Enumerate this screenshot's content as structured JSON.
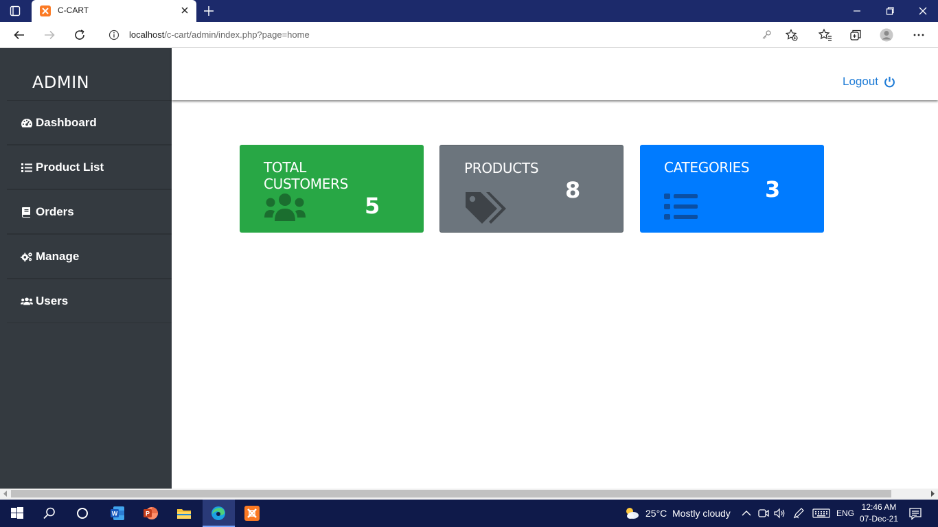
{
  "browser": {
    "tab_title": "C-CART",
    "url_host": "localhost",
    "url_path": "/c-cart/admin/index.php?page=home"
  },
  "sidebar": {
    "brand": "ADMIN",
    "items": [
      {
        "label": "Dashboard",
        "icon": "tachometer-icon"
      },
      {
        "label": "Product List",
        "icon": "list-icon"
      },
      {
        "label": "Orders",
        "icon": "book-icon"
      },
      {
        "label": "Manage",
        "icon": "cogs-icon"
      },
      {
        "label": "Users",
        "icon": "users-icon"
      }
    ]
  },
  "header": {
    "logout_label": "Logout"
  },
  "cards": [
    {
      "title": "TOTAL CUSTOMERS",
      "count": "5",
      "color": "#28a745",
      "icon": "users-icon"
    },
    {
      "title": "PRODUCTS",
      "count": "8",
      "color": "#6c757d",
      "icon": "tags-icon"
    },
    {
      "title": "CATEGORIES",
      "count": "3",
      "color": "#007bff",
      "icon": "list-icon"
    }
  ],
  "taskbar": {
    "weather_temp": "25°C",
    "weather_desc": "Mostly cloudy",
    "language": "ENG",
    "time": "12:46 AM",
    "date": "07-Dec-21"
  }
}
